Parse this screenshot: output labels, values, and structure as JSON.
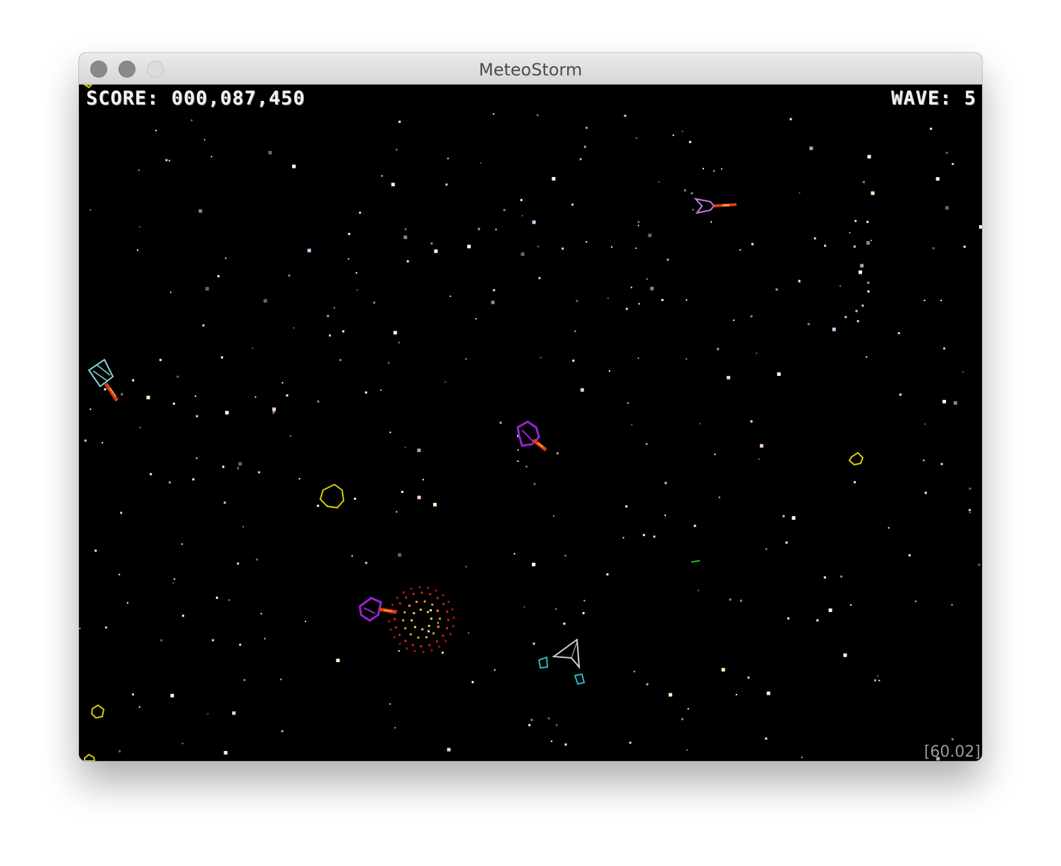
{
  "window": {
    "title": "MeteoStorm"
  },
  "hud": {
    "score_label": "SCORE:",
    "score_value": "000,087,450",
    "wave_label": "WAVE:",
    "wave_value": "5",
    "fps": "[60.02]"
  },
  "colors": {
    "background": "#000000",
    "hud_text": "#f2f2f2",
    "asteroid": "#d8d000",
    "enemy_purple": "#9b22d6",
    "enemy_pink": "#c27fd8",
    "enemy_cyan": "#7fd8d8",
    "player_ship": "#d0d0d0",
    "player_option": "#2ab8c8",
    "explosion_red": "#cc1111",
    "explosion_yellow": "#e8c020"
  },
  "icons": {
    "window_close": "close-icon",
    "window_minimize": "minimize-icon",
    "window_zoom": "zoom-icon"
  }
}
